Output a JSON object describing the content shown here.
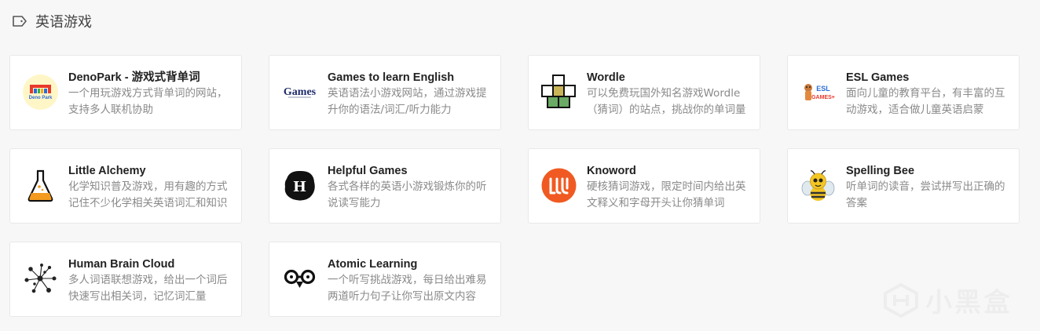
{
  "section": {
    "title": "英语游戏",
    "icon": "tag-icon"
  },
  "cards": [
    {
      "name": "DenoPark - 游戏式背单词",
      "desc": "一个用玩游戏方式背单词的网站，支持多人联机协助",
      "icon": "denopark-logo-icon"
    },
    {
      "name": "Games to learn English",
      "desc": "英语语法小游戏网站，通过游戏提升你的语法/词汇/听力能力",
      "icon": "games-logo-icon"
    },
    {
      "name": "Wordle",
      "desc": "可以免费玩国外知名游戏Wordle（猜词）的站点，挑战你的单词量",
      "icon": "wordle-logo-icon"
    },
    {
      "name": "ESL Games",
      "desc": "面向儿童的教育平台，有丰富的互动游戏，适合做儿童英语启蒙",
      "icon": "esl-games-logo-icon"
    },
    {
      "name": "Little Alchemy",
      "desc": "化学知识普及游戏，用有趣的方式记住不少化学相关英语词汇和知识",
      "icon": "flask-logo-icon"
    },
    {
      "name": "Helpful Games",
      "desc": "各式各样的英语小游戏锻炼你的听说读写能力",
      "icon": "helpful-games-logo-icon"
    },
    {
      "name": "Knoword",
      "desc": "硬核猜词游戏，限定时间内给出英文释义和字母开头让你猜单词",
      "icon": "knoword-logo-icon"
    },
    {
      "name": "Spelling Bee",
      "desc": "听单词的读音，尝试拼写出正确的答案",
      "icon": "bee-logo-icon"
    },
    {
      "name": "Human Brain Cloud",
      "desc": "多人词语联想游戏，给出一个词后快速写出相关词，记忆词汇量",
      "icon": "brain-cloud-logo-icon"
    },
    {
      "name": "Atomic Learning",
      "desc": "一个听写挑战游戏，每日给出难易两道听力句子让你写出原文内容",
      "icon": "atomic-learning-logo-icon"
    }
  ],
  "watermark": {
    "text": "小黑盒"
  },
  "logo_text": {
    "denopark": "Deno Park",
    "games": "Games",
    "esl_1": "ESL",
    "esl_2": "GAMES+",
    "helpful": "H"
  },
  "colors": {
    "background": "#f7f7f7",
    "card": "#ffffff",
    "title": "#222222",
    "desc": "#8a8a8a",
    "knoword": "#f05a22",
    "bee": "#f3c623"
  }
}
